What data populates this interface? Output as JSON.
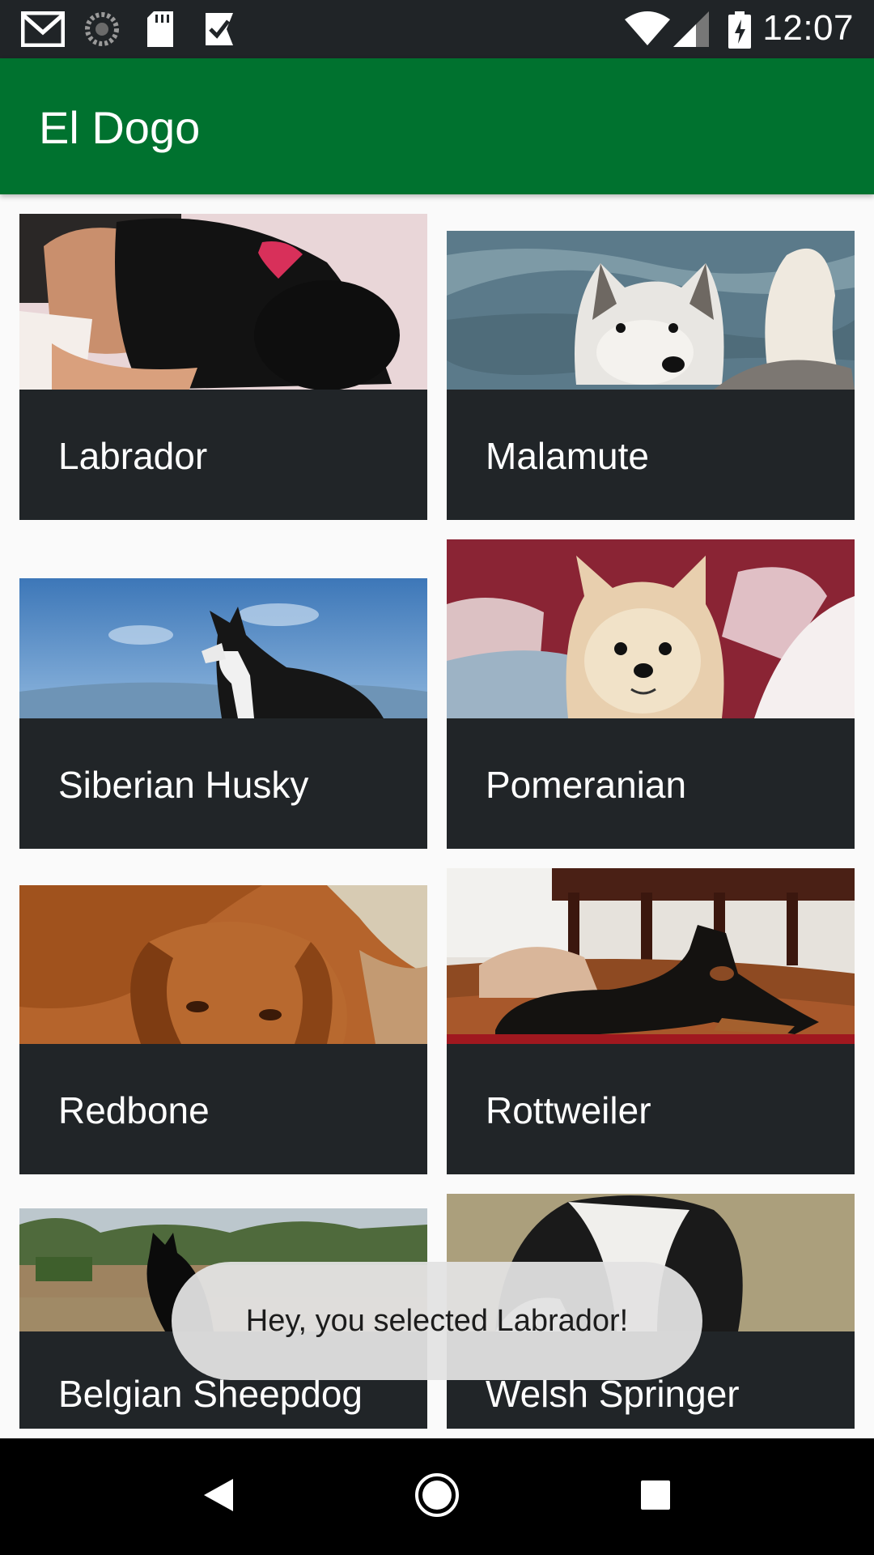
{
  "status_bar": {
    "time": "12:07",
    "left_icons": [
      "gmail-icon",
      "sync-icon",
      "sd-card-icon",
      "task-check-icon"
    ],
    "right_icons": [
      "wifi-icon",
      "cell-signal-icon",
      "battery-icon"
    ]
  },
  "app_bar": {
    "title": "El Dogo"
  },
  "breeds": [
    {
      "name": "Labrador"
    },
    {
      "name": "Malamute"
    },
    {
      "name": "Siberian Husky"
    },
    {
      "name": "Pomeranian"
    },
    {
      "name": "Redbone"
    },
    {
      "name": "Rottweiler"
    },
    {
      "name": "Belgian Sheepdog"
    },
    {
      "name": "Welsh Springer"
    }
  ],
  "toast": {
    "message": "Hey, you selected Labrador!"
  },
  "nav_bar": {
    "buttons": [
      "back-icon",
      "home-icon",
      "recents-icon"
    ]
  },
  "colors": {
    "app_bar": "#00722f",
    "status_bar": "#202427",
    "card_label_bg": "#212528",
    "background": "#fafafa"
  }
}
